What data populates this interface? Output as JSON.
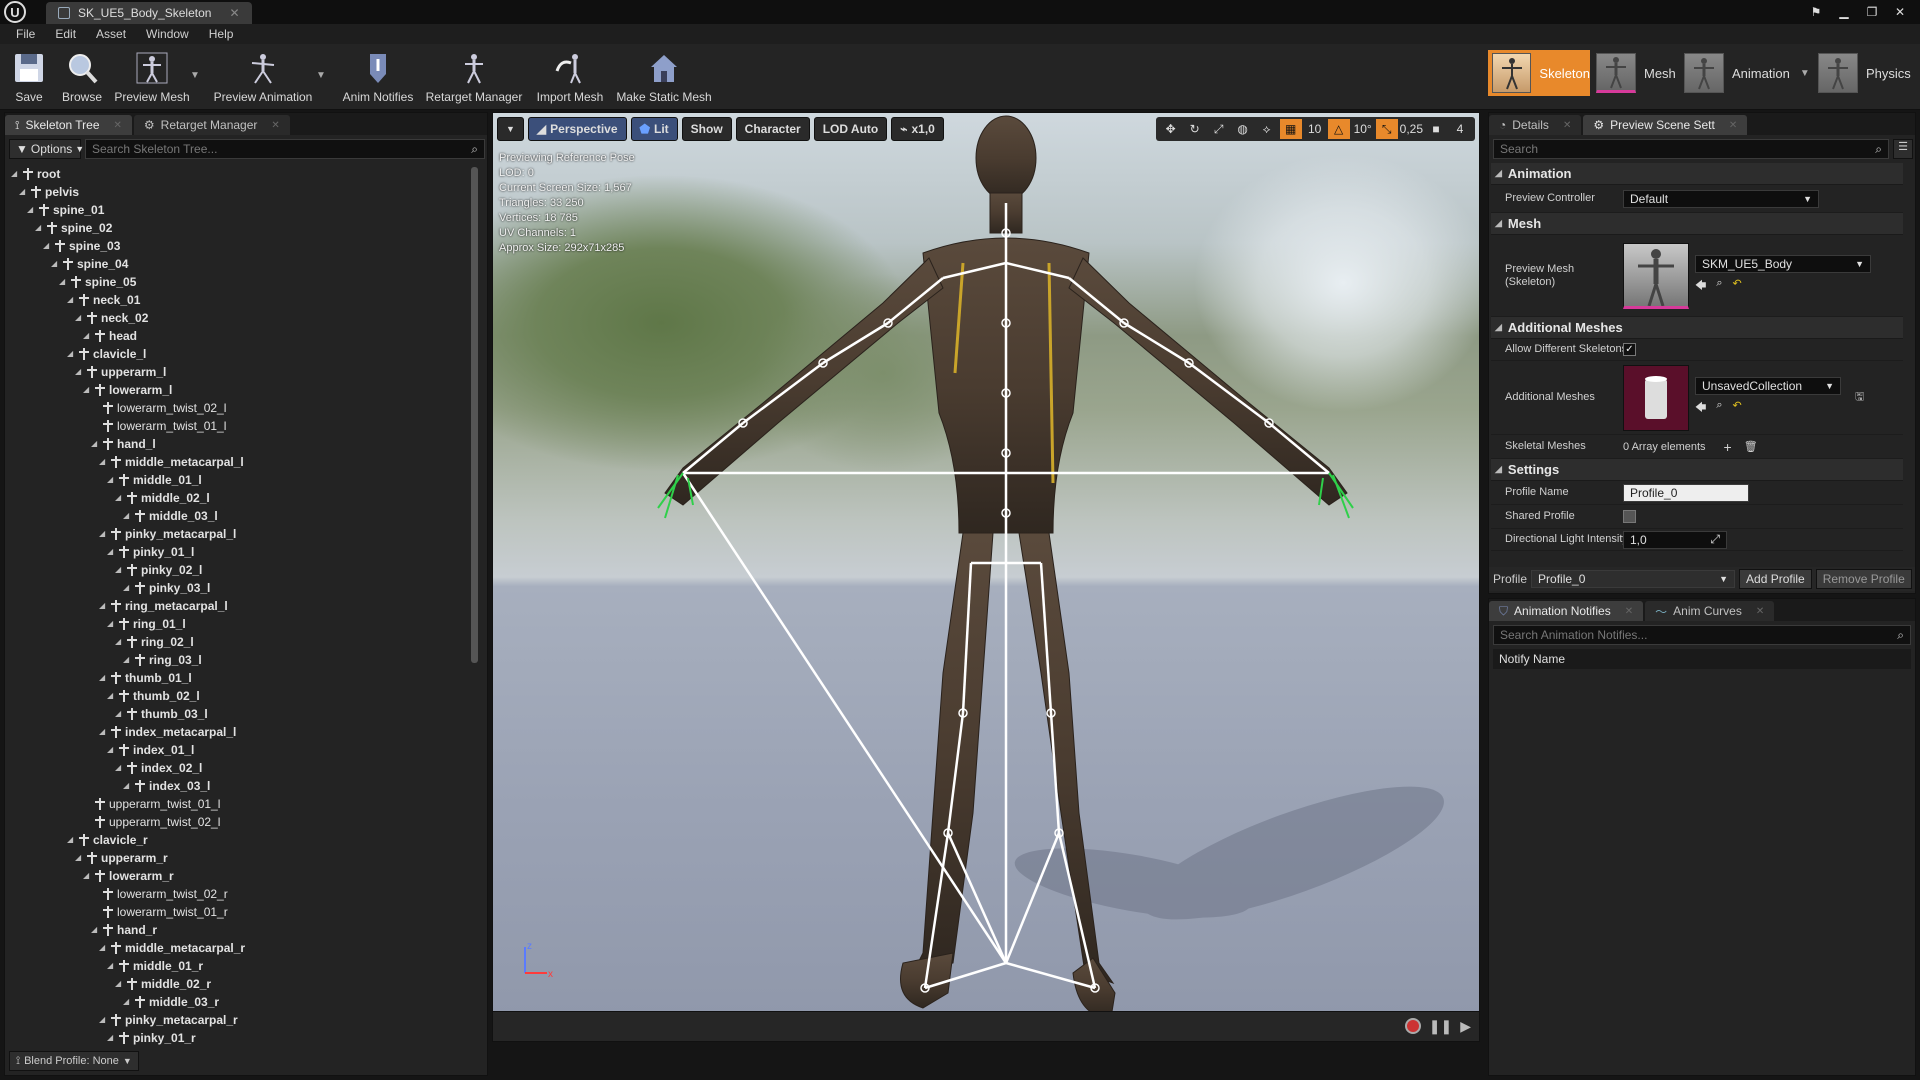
{
  "window": {
    "tab_title": "SK_UE5_Body_Skeleton"
  },
  "menu": [
    "File",
    "Edit",
    "Asset",
    "Window",
    "Help"
  ],
  "toolbar": {
    "buttons": [
      "Save",
      "Browse",
      "Preview Mesh",
      "Preview Animation",
      "Anim Notifies",
      "Retarget Manager",
      "Import Mesh",
      "Make Static Mesh"
    ],
    "modes": [
      "Skeleton",
      "Mesh",
      "Animation",
      "Physics"
    ]
  },
  "left_panel": {
    "tabs": [
      "Skeleton Tree",
      "Retarget Manager"
    ],
    "options_label": "Options",
    "search_placeholder": "Search Skeleton Tree...",
    "blend_profile": "Blend Profile: None",
    "tree": [
      {
        "name": "root",
        "depth": 0
      },
      {
        "name": "pelvis",
        "depth": 1
      },
      {
        "name": "spine_01",
        "depth": 2
      },
      {
        "name": "spine_02",
        "depth": 3
      },
      {
        "name": "spine_03",
        "depth": 4
      },
      {
        "name": "spine_04",
        "depth": 5
      },
      {
        "name": "spine_05",
        "depth": 6
      },
      {
        "name": "neck_01",
        "depth": 7
      },
      {
        "name": "neck_02",
        "depth": 8
      },
      {
        "name": "head",
        "depth": 9
      },
      {
        "name": "clavicle_l",
        "depth": 7
      },
      {
        "name": "upperarm_l",
        "depth": 8
      },
      {
        "name": "lowerarm_l",
        "depth": 9
      },
      {
        "name": "lowerarm_twist_02_l",
        "depth": 10,
        "leaf": true
      },
      {
        "name": "lowerarm_twist_01_l",
        "depth": 10,
        "leaf": true
      },
      {
        "name": "hand_l",
        "depth": 10
      },
      {
        "name": "middle_metacarpal_l",
        "depth": 11
      },
      {
        "name": "middle_01_l",
        "depth": 12
      },
      {
        "name": "middle_02_l",
        "depth": 13
      },
      {
        "name": "middle_03_l",
        "depth": 14
      },
      {
        "name": "pinky_metacarpal_l",
        "depth": 11
      },
      {
        "name": "pinky_01_l",
        "depth": 12
      },
      {
        "name": "pinky_02_l",
        "depth": 13
      },
      {
        "name": "pinky_03_l",
        "depth": 14
      },
      {
        "name": "ring_metacarpal_l",
        "depth": 11
      },
      {
        "name": "ring_01_l",
        "depth": 12
      },
      {
        "name": "ring_02_l",
        "depth": 13
      },
      {
        "name": "ring_03_l",
        "depth": 14
      },
      {
        "name": "thumb_01_l",
        "depth": 11
      },
      {
        "name": "thumb_02_l",
        "depth": 12
      },
      {
        "name": "thumb_03_l",
        "depth": 13
      },
      {
        "name": "index_metacarpal_l",
        "depth": 11
      },
      {
        "name": "index_01_l",
        "depth": 12
      },
      {
        "name": "index_02_l",
        "depth": 13
      },
      {
        "name": "index_03_l",
        "depth": 14
      },
      {
        "name": "upperarm_twist_01_l",
        "depth": 9,
        "leaf": true
      },
      {
        "name": "upperarm_twist_02_l",
        "depth": 9,
        "leaf": true
      },
      {
        "name": "clavicle_r",
        "depth": 7
      },
      {
        "name": "upperarm_r",
        "depth": 8
      },
      {
        "name": "lowerarm_r",
        "depth": 9
      },
      {
        "name": "lowerarm_twist_02_r",
        "depth": 10,
        "leaf": true
      },
      {
        "name": "lowerarm_twist_01_r",
        "depth": 10,
        "leaf": true
      },
      {
        "name": "hand_r",
        "depth": 10
      },
      {
        "name": "middle_metacarpal_r",
        "depth": 11
      },
      {
        "name": "middle_01_r",
        "depth": 12
      },
      {
        "name": "middle_02_r",
        "depth": 13
      },
      {
        "name": "middle_03_r",
        "depth": 14
      },
      {
        "name": "pinky_metacarpal_r",
        "depth": 11
      },
      {
        "name": "pinky_01_r",
        "depth": 12
      }
    ]
  },
  "viewport": {
    "buttons": [
      "Perspective",
      "Lit",
      "Show",
      "Character",
      "LOD Auto",
      "x1,0"
    ],
    "snap_values": [
      "10",
      "10°",
      "0,25",
      "4"
    ],
    "info": [
      "Previewing Reference Pose",
      "LOD: 0",
      "Current Screen Size: 1,567",
      "Triangles: 33 250",
      "Vertices: 18 785",
      "UV Channels: 1",
      "Approx Size: 292x71x285"
    ]
  },
  "details": {
    "tabs": [
      "Details",
      "Preview Scene Sett"
    ],
    "search_placeholder": "Search",
    "sections": {
      "animation": "Animation",
      "mesh": "Mesh",
      "additional": "Additional Meshes",
      "settings": "Settings"
    },
    "preview_controller_label": "Preview Controller",
    "preview_controller_value": "Default",
    "preview_mesh_label": "Preview Mesh (Skeleton)",
    "preview_mesh_value": "SKM_UE5_Body",
    "allow_diff_label": "Allow Different Skeletons",
    "additional_meshes_label": "Additional Meshes",
    "additional_meshes_value": "UnsavedCollection",
    "skeletal_meshes_label": "Skeletal Meshes",
    "skeletal_meshes_value": "0 Array elements",
    "profile_name_label": "Profile Name",
    "profile_name_value": "Profile_0",
    "shared_profile_label": "Shared Profile",
    "dir_light_label": "Directional Light Intensity",
    "dir_light_value": "1,0",
    "profile_label": "Profile",
    "profile_value": "Profile_0",
    "add_profile": "Add Profile",
    "remove_profile": "Remove Profile"
  },
  "notifies": {
    "tabs": [
      "Animation Notifies",
      "Anim Curves"
    ],
    "search_placeholder": "Search Animation Notifies...",
    "header": "Notify Name"
  },
  "colors": {
    "accent_orange": "#e8892b",
    "mesh_pink": "#d63a9a",
    "skeleton_white": "#ffffff"
  }
}
